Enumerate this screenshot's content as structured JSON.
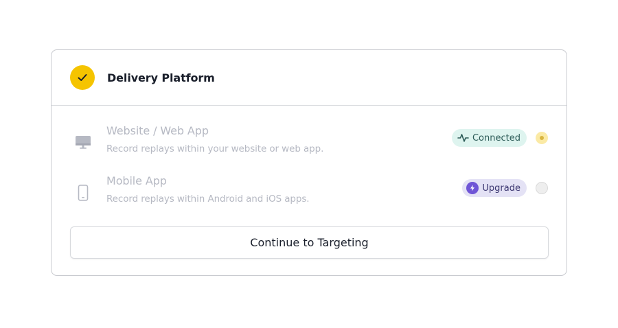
{
  "header": {
    "title": "Delivery Platform",
    "status_icon": "check-icon",
    "accent_color": "#f5c400"
  },
  "options": [
    {
      "icon": "monitor-icon",
      "title": "Website / Web App",
      "description": "Record replays within your website or web app.",
      "badge": {
        "label": "Connected",
        "icon": "activity-icon",
        "color": "#def4ef"
      },
      "selected": true
    },
    {
      "icon": "mobile-icon",
      "title": "Mobile App",
      "description": "Record replays within Android and iOS apps.",
      "badge": {
        "label": "Upgrade",
        "icon": "bolt-icon",
        "color": "#e4e2f5"
      },
      "selected": false
    }
  ],
  "footer": {
    "continue_label": "Continue to Targeting"
  }
}
